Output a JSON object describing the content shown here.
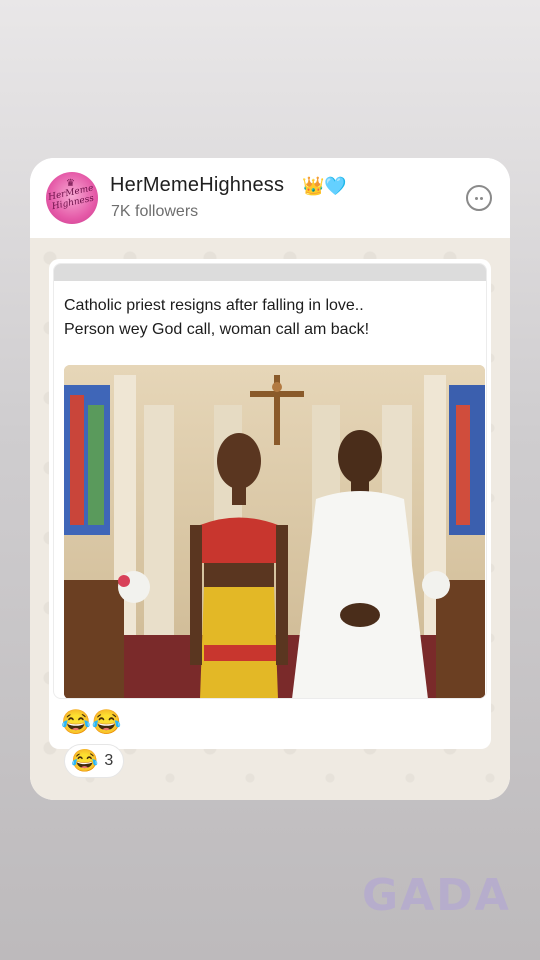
{
  "channel": {
    "name": "HerMemeHighness",
    "badges": "👑🩵",
    "followers": "7K followers",
    "avatar_text": "HerMeme Highness"
  },
  "post": {
    "text_line1": "Catholic priest resigns after falling in love..",
    "text_line2": "Person wey God call, woman call am back!",
    "caption_emojis": "😂😂",
    "photo_subject": "woman in colorful dress and priest in white cassock standing in a church"
  },
  "reaction": {
    "emoji": "😂",
    "count": "3"
  },
  "watermark": {
    "text": "GADA"
  },
  "icons": {
    "menu": "chat-bubble-dots-icon"
  }
}
